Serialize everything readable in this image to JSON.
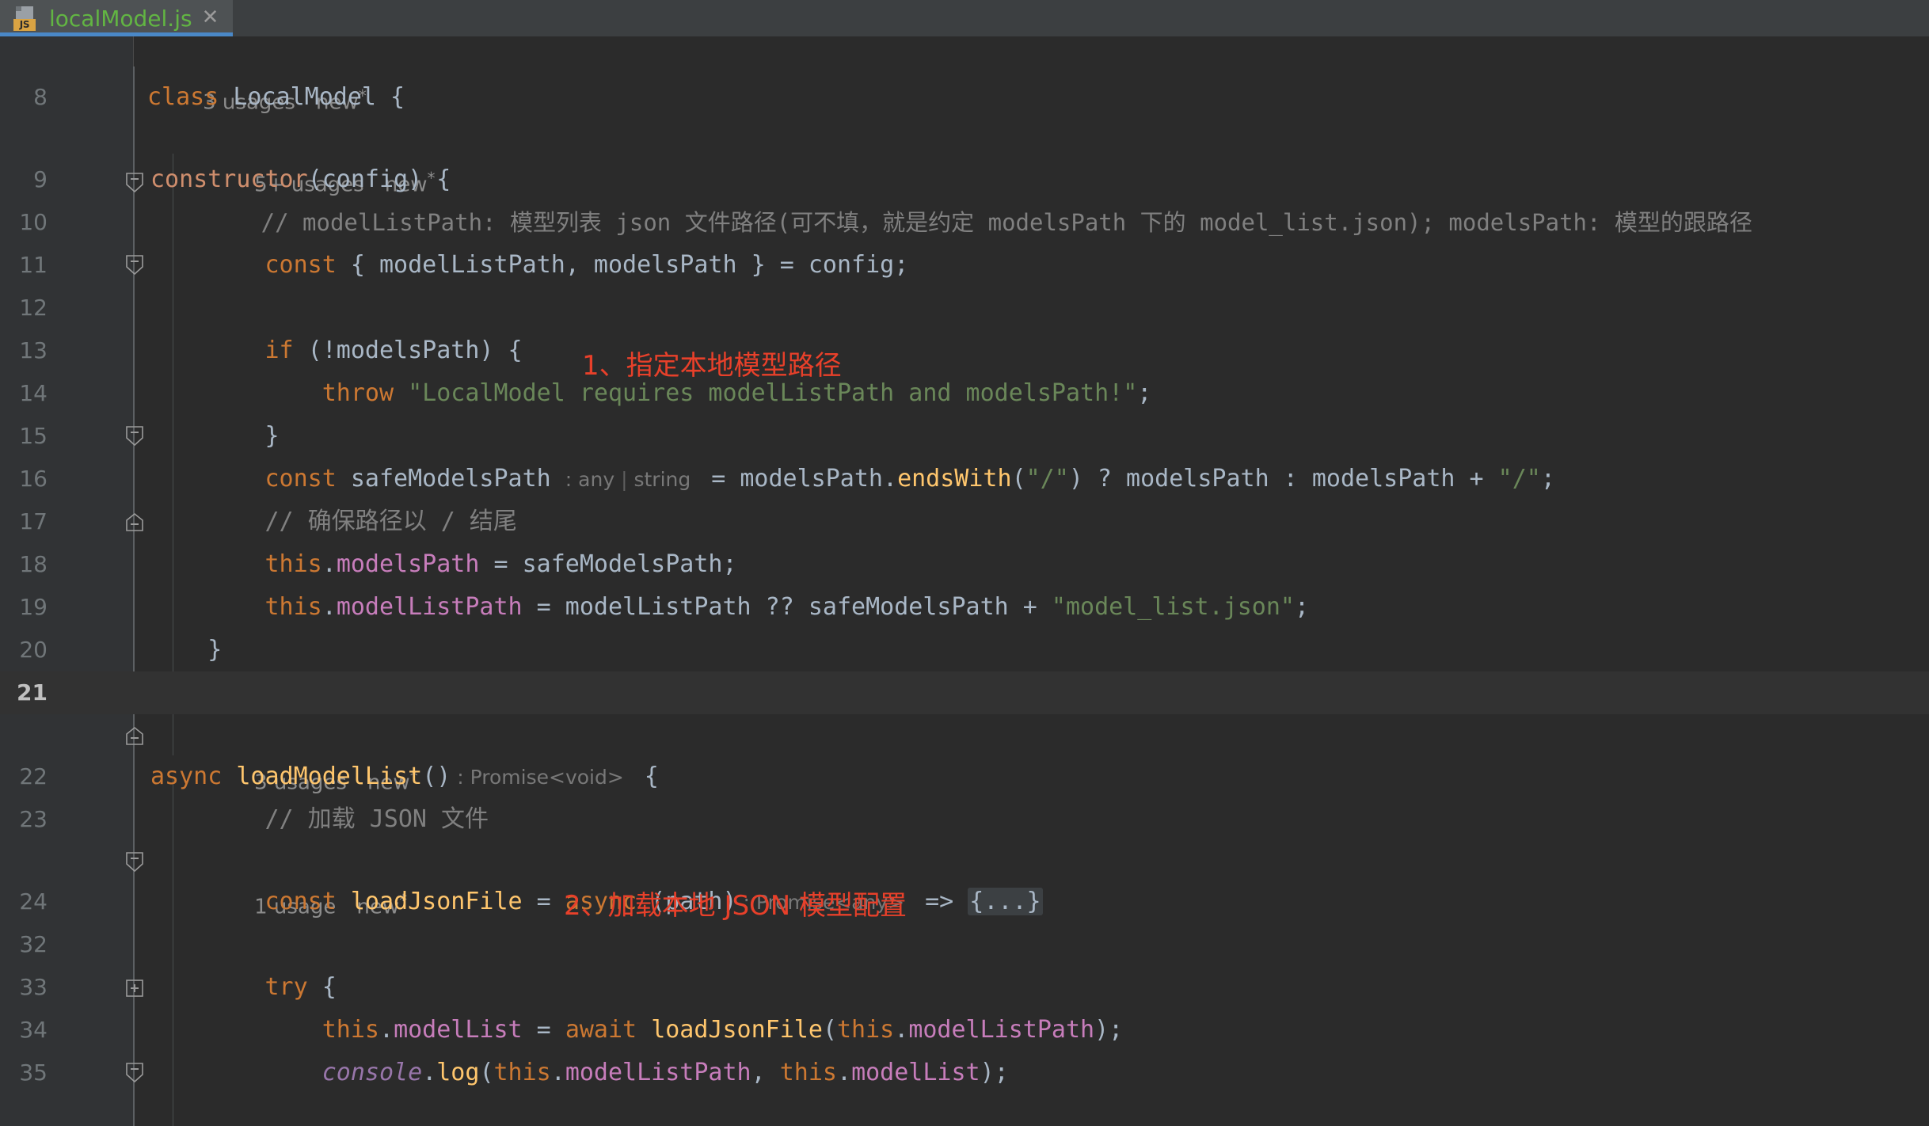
{
  "tab": {
    "filename": "localModel.js",
    "icon_badge": "JS",
    "close_glyph": "✕",
    "accent_color": "#4a88c7",
    "filename_color": "#62b543"
  },
  "editor": {
    "theme": "darcula",
    "background": "#2b2b2b",
    "gutter_background": "#313335",
    "current_line": 21,
    "annotations": [
      {
        "text": "1、指定本地模型路径",
        "color": "#e8402a"
      },
      {
        "text": "2、加载本地 JSON 模型配置",
        "color": "#e8402a"
      }
    ],
    "hints": [
      {
        "usages": "3 usages",
        "new": "new",
        "star": "*"
      },
      {
        "usages": "5+ usages",
        "new": "new",
        "star": "*"
      },
      {
        "usages": "3 usages",
        "new": "new",
        "star": "*"
      },
      {
        "usages": "1 usage",
        "new": "new",
        "star": "*"
      }
    ],
    "lines": [
      {
        "no": "8",
        "text": "class LocalModel {"
      },
      {
        "no": "9",
        "text": "    constructor(config) {"
      },
      {
        "no": "10",
        "text": "        // modelListPath: 模型列表 json 文件路径(可不填，就是约定 modelsPath 下的 model_list.json); modelsPath: 模型的跟路径"
      },
      {
        "no": "11",
        "text": "        const { modelListPath, modelsPath } = config;"
      },
      {
        "no": "12",
        "text": ""
      },
      {
        "no": "13",
        "text": "        if (!modelsPath) {"
      },
      {
        "no": "14",
        "text": "            throw \"LocalModel requires modelListPath and modelsPath!\";"
      },
      {
        "no": "15",
        "text": "        }"
      },
      {
        "no": "16",
        "text": "        const safeModelsPath : any | string  = modelsPath.endsWith(\"/\") ? modelsPath : modelsPath + \"/\";"
      },
      {
        "no": "17",
        "text": "        // 确保路径以 / 结尾"
      },
      {
        "no": "18",
        "text": "        this.modelsPath = safeModelsPath;"
      },
      {
        "no": "19",
        "text": "        this.modelListPath = modelListPath ?? safeModelsPath + \"model_list.json\";"
      },
      {
        "no": "20",
        "text": "    }"
      },
      {
        "no": "21",
        "text": ""
      },
      {
        "no": "22",
        "text": "    async loadModelList() : Promise<void>  {"
      },
      {
        "no": "23",
        "text": "        // 加载 JSON 文件"
      },
      {
        "no": "24",
        "text": "        const loadJsonFile = async (path) : Promise<any>  => {...}"
      },
      {
        "no": "32",
        "text": ""
      },
      {
        "no": "33",
        "text": "        try {"
      },
      {
        "no": "34",
        "text": "            this.modelList = await loadJsonFile(this.modelListPath);"
      },
      {
        "no": "35",
        "text": "            console.log(this.modelListPath, this.modelList);"
      }
    ],
    "inlay_hints": [
      {
        "line": "16",
        "text": "any | string"
      },
      {
        "line": "22",
        "text": "Promise<void>"
      },
      {
        "line": "24",
        "text": "Promise<any>"
      }
    ],
    "fold_markers": [
      {
        "line": "8",
        "state": "collapse"
      },
      {
        "line": "9",
        "state": "collapse"
      },
      {
        "line": "13",
        "state": "collapse"
      },
      {
        "line": "15",
        "state": "end"
      },
      {
        "line": "20",
        "state": "end"
      },
      {
        "line": "22",
        "state": "collapse"
      },
      {
        "line": "24",
        "state": "expand"
      },
      {
        "line": "33",
        "state": "collapse"
      }
    ],
    "collapsed_block": "{...}"
  }
}
